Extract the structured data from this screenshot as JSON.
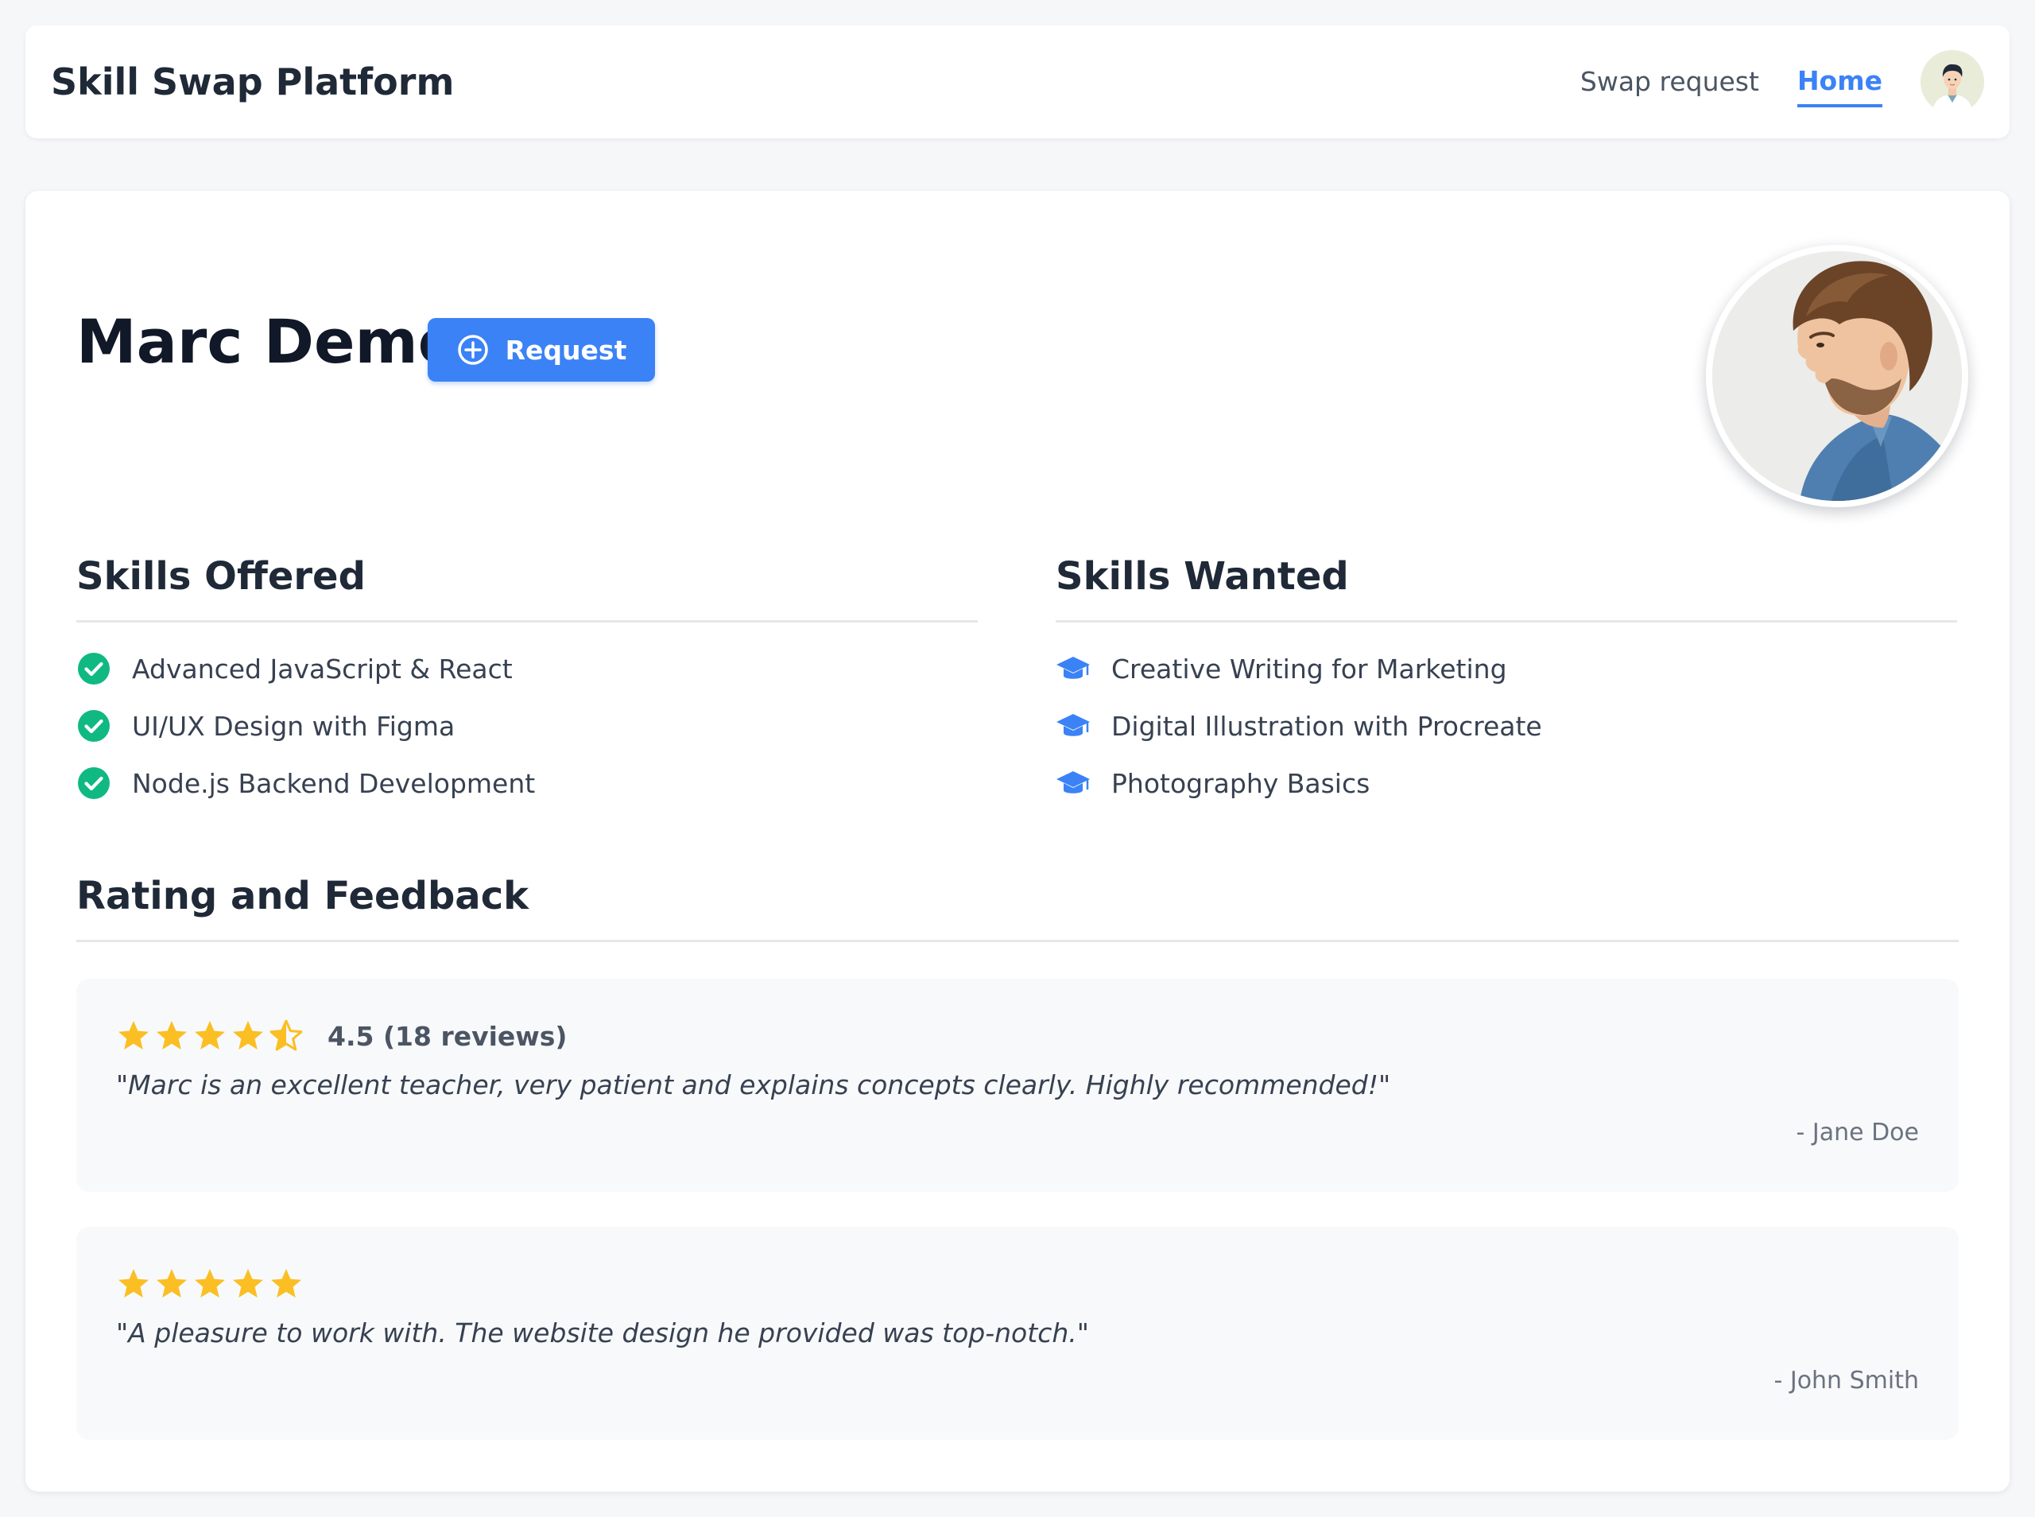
{
  "navbar": {
    "brand": "Skill Swap Platform",
    "links": [
      {
        "label": "Swap request",
        "active": false
      },
      {
        "label": "Home",
        "active": true
      }
    ],
    "avatar_icon": "user-avatar-icon"
  },
  "profile": {
    "name": "Marc Demo",
    "request_button_label": "Request",
    "request_button_icon": "plus-circle-icon",
    "accent_color": "#3b82f6"
  },
  "skills_offered": {
    "heading": "Skills Offered",
    "icon": "check-circle-icon",
    "icon_color": "#10b981",
    "items": [
      "Advanced JavaScript & React",
      "UI/UX Design with Figma",
      "Node.js Backend Development"
    ]
  },
  "skills_wanted": {
    "heading": "Skills Wanted",
    "icon": "graduation-cap-icon",
    "icon_color": "#3b82f6",
    "items": [
      "Creative Writing for Marketing",
      "Digital Illustration with Procreate",
      "Photography Basics"
    ]
  },
  "rating_feedback": {
    "heading": "Rating and Feedback",
    "star_color": "#fbbf24",
    "reviews": [
      {
        "rating": 4.5,
        "summary": "4.5 (18 reviews)",
        "quote": "\"Marc is an excellent teacher, very patient and explains concepts clearly. Highly recommended!\"",
        "author": "- Jane Doe"
      },
      {
        "rating": 5,
        "summary": "",
        "quote": "\"A pleasure to work with. The website design he provided was top-notch.\"",
        "author": "- John Smith"
      }
    ]
  }
}
